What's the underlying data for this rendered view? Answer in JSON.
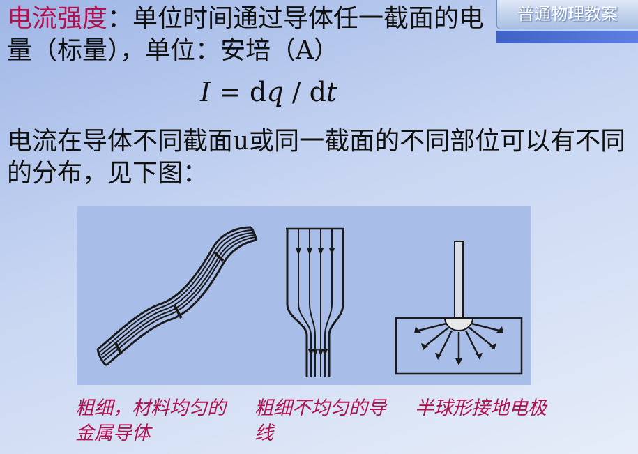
{
  "header": {
    "badge_label": "普通物理教案"
  },
  "content": {
    "term": "电流强度",
    "definition": "：单位时间通过导体任一截面的电量（标量），单位：安培（A）",
    "formula": {
      "lhs": "I",
      "eq": " = ",
      "d1": "d",
      "q": "q",
      "slash": " / ",
      "d2": "d",
      "t": "t"
    },
    "distribution_text": "电流在导体不同截面u或同一截面的不同部位可以有不同的分布，见下图："
  },
  "figure": {
    "captions": [
      "粗细，材料均匀的金属导体",
      "粗细不均匀的导线",
      "半球形接地电极"
    ]
  },
  "colors": {
    "term": "#b0124f",
    "badge_bar": "#3f62c4",
    "figure_bg": "#a8bde7"
  }
}
